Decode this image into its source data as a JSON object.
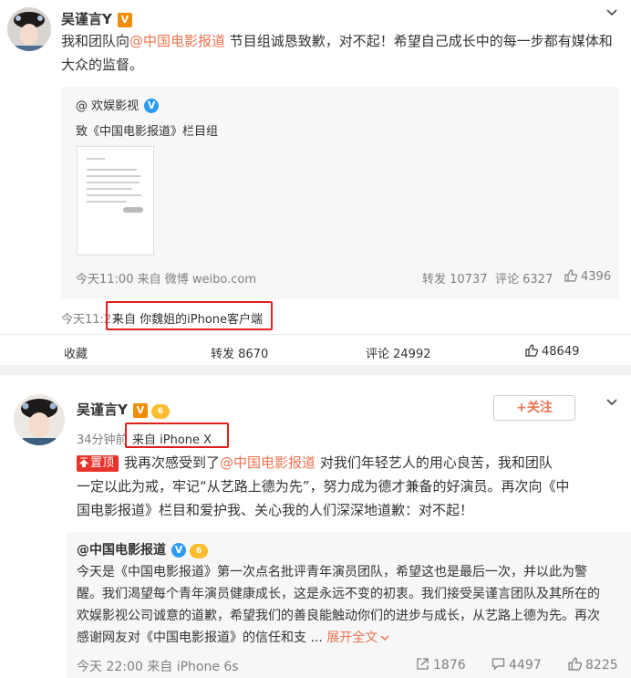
{
  "post1": {
    "author": "吴谨言Y",
    "text_before": "我和团队向",
    "mention": "@中国电影报道",
    "text_after": " 节目组诚恳致歉，对不起！希望自己成长中的每一步都有媒体和大众的监督。",
    "repost": {
      "author": "@ 欢娱影视",
      "text": "致《中国电影报道》栏目组",
      "time_source": "今天11:00 来自 微博 weibo.com",
      "forward": "转发 10737",
      "comment": "评论 6327",
      "like": "4396"
    },
    "time": "今天11:27",
    "source": "来自 你魏姐的iPhone客户端",
    "bar": {
      "collect": "收藏",
      "forward": "转发 8670",
      "comment": "评论 24992",
      "like": "48649"
    }
  },
  "post2": {
    "author": "吴谨言Y",
    "follow": "+关注",
    "time": "34分钟前",
    "source": "来自 iPhone X",
    "pin": "置顶",
    "line1_a": "我再次感受到了",
    "line1_mention": "@中国电影报道",
    "line1_b": " 对我们年轻艺人的用心良苦，我和团队",
    "line2": "一定以此为戒，牢记“从艺路上德为先”，努力成为德才兼备的好演员。再次向《中",
    "line3": "国电影报道》栏目和爱护我、关心我的人们深深地道歉：对不起！",
    "repost": {
      "author": "@中国电影报道",
      "line1": "今天是《中国电影报道》第一次点名批评青年演员团队，希望这也是最后一次，并以此为警",
      "line2": "醒。我们渴望每个青年演员健康成长，这是永远不变的初衷。我们接受吴谨言团队及其所在的",
      "line3": "欢娱影视公司诚意的道歉，希望我们的善良能触动你们的进步与成长，从艺路上德为先。再次",
      "line4": "感谢网友对《中国电影报道》的信任和支 ...",
      "expand": "展开全文",
      "time_source": "今天 22:00 来自 iPhone 6s",
      "forward": "1876",
      "comment": "4497",
      "like": "8225"
    }
  },
  "colors": {
    "accent": "#eb7350",
    "highlight_box": "#e02020",
    "verified_orange": "#f28c00",
    "verified_blue": "#2b9bf4"
  }
}
